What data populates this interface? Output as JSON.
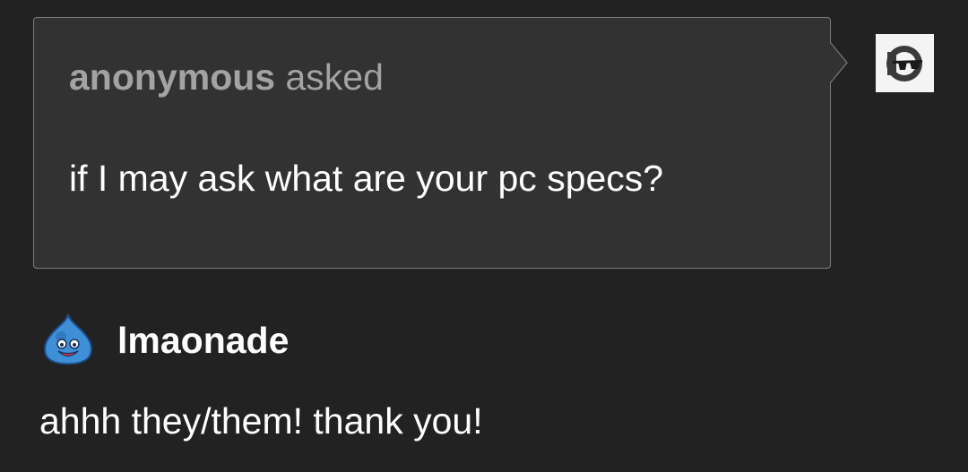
{
  "ask": {
    "asker": "anonymous",
    "verb": " asked",
    "question": "if I may ask what are your pc specs?",
    "avatar_icon": "sunglasses-face-icon"
  },
  "answer": {
    "author": "lmaonade",
    "avatar_icon": "blue-slime-icon",
    "text": "ahhh they/them! thank you!"
  },
  "colors": {
    "background": "#222222",
    "ask_box": "#323232",
    "ask_border": "#7a7a7a",
    "muted_text": "#a3a3a3",
    "text": "#ffffff"
  }
}
